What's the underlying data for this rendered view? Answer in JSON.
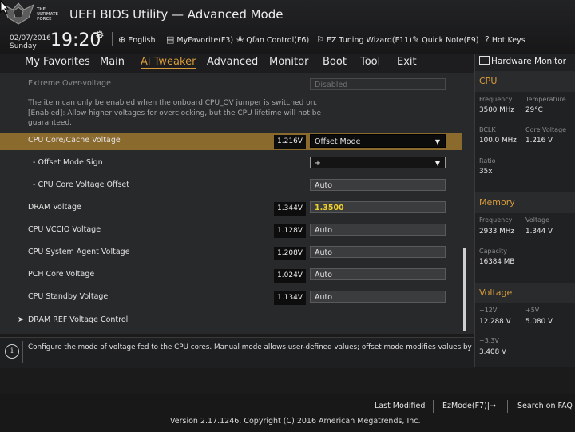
{
  "header": {
    "logo_text": "THE ULTIMATE FORCE",
    "title": "UEFI BIOS Utility — Advanced Mode",
    "date": "02/07/2016",
    "day": "Sunday",
    "time": "19:20",
    "items": [
      {
        "icon": "globe-icon",
        "glyph": "⊕",
        "label": "English"
      },
      {
        "icon": "favorite-icon",
        "glyph": "▤",
        "label": "MyFavorite(F3)"
      },
      {
        "icon": "fan-icon",
        "glyph": "❀",
        "label": "Qfan Control(F6)"
      },
      {
        "icon": "wizard-icon",
        "glyph": "⚐",
        "label": "EZ Tuning Wizard(F11)"
      },
      {
        "icon": "note-icon",
        "glyph": "✎",
        "label": "Quick Note(F9)"
      },
      {
        "icon": "hotkeys-icon",
        "glyph": "?",
        "label": "Hot Keys"
      }
    ]
  },
  "menu": [
    "My Favorites",
    "Main",
    "Ai Tweaker",
    "Advanced",
    "Monitor",
    "Boot",
    "Tool",
    "Exit"
  ],
  "active_menu": "Ai Tweaker",
  "settings": {
    "extreme_label": "Extreme Over-voltage",
    "extreme_value": "Disabled",
    "info_line1": "The item can only be enabled when the onboard CPU_OV jumper is switched on.",
    "info_line2": "[Enabled]: Allow higher voltages for overclocking, but the CPU lifetime will not be guaranteed.",
    "rows": [
      {
        "label": "CPU Core/Cache Voltage",
        "voltage": "1.216V",
        "value": "Offset Mode"
      },
      {
        "label": "- Offset Mode Sign",
        "value": "+"
      },
      {
        "label": "- CPU Core Voltage Offset",
        "value": "Auto"
      },
      {
        "label": "DRAM Voltage",
        "voltage": "1.344V",
        "value": "1.3500"
      },
      {
        "label": "CPU VCCIO Voltage",
        "voltage": "1.128V",
        "value": "Auto"
      },
      {
        "label": "CPU System Agent Voltage",
        "voltage": "1.208V",
        "value": "Auto"
      },
      {
        "label": "PCH Core Voltage",
        "voltage": "1.024V",
        "value": "Auto"
      },
      {
        "label": "CPU Standby Voltage",
        "voltage": "1.134V",
        "value": "Auto"
      }
    ],
    "submenu": "DRAM REF Voltage Control"
  },
  "help_text": "Configure the mode of voltage fed to the CPU cores. Manual mode allows user-defined values; offset mode modifies values by SVID.",
  "hardware_monitor": {
    "title": "Hardware Monitor",
    "cpu": {
      "heading": "CPU",
      "frequency_label": "Frequency",
      "frequency": "3500 MHz",
      "temperature_label": "Temperature",
      "temperature": "29°C",
      "bclk_label": "BCLK",
      "bclk": "100.0 MHz",
      "core_voltage_label": "Core Voltage",
      "core_voltage": "1.216 V",
      "ratio_label": "Ratio",
      "ratio": "35x"
    },
    "memory": {
      "heading": "Memory",
      "frequency_label": "Frequency",
      "frequency": "2933 MHz",
      "voltage_label": "Voltage",
      "voltage": "1.344 V",
      "capacity_label": "Capacity",
      "capacity": "16384 MB"
    },
    "voltage": {
      "heading": "Voltage",
      "v12_label": "+12V",
      "v12": "12.288 V",
      "v5_label": "+5V",
      "v5": "5.080 V",
      "v33_label": "+3.3V",
      "v33": "3.408 V"
    }
  },
  "footer": {
    "last_modified": "Last Modified",
    "ezmode": "EzMode(F7)|→",
    "search": "Search on FAQ",
    "version": "Version 2.17.1246. Copyright (C) 2016 American Megatrends, Inc."
  },
  "colors": {
    "accent": "#d79b3c",
    "highlight": "#8b6a2e",
    "dram_value": "#f2d22a"
  }
}
